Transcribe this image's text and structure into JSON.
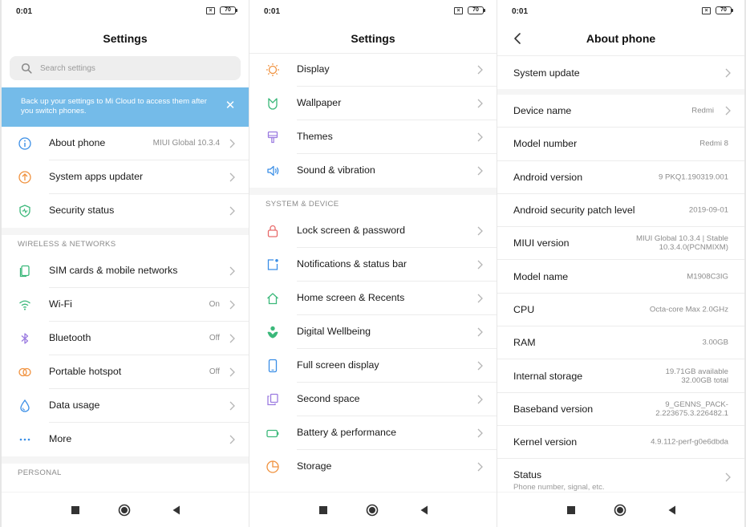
{
  "status": {
    "time": "0:01",
    "battery": "70"
  },
  "screen1": {
    "title": "Settings",
    "search_placeholder": "Search settings",
    "banner_text": "Back up your settings to Mi Cloud to access them after you switch phones.",
    "banner_close": "✕",
    "group1": [
      {
        "label": "About phone",
        "value": "MIUI Global 10.3.4",
        "icon": "info-icon"
      },
      {
        "label": "System apps updater",
        "value": "",
        "icon": "arrow-up-circle-icon"
      },
      {
        "label": "Security status",
        "value": "",
        "icon": "shield-check-icon"
      }
    ],
    "section_wireless": "WIRELESS & NETWORKS",
    "group2": [
      {
        "label": "SIM cards & mobile networks",
        "value": "",
        "icon": "sim-card-icon"
      },
      {
        "label": "Wi-Fi",
        "value": "On",
        "icon": "wifi-icon"
      },
      {
        "label": "Bluetooth",
        "value": "Off",
        "icon": "bluetooth-icon"
      },
      {
        "label": "Portable hotspot",
        "value": "Off",
        "icon": "hotspot-icon"
      },
      {
        "label": "Data usage",
        "value": "",
        "icon": "water-drop-icon"
      },
      {
        "label": "More",
        "value": "",
        "icon": "more-dots-icon"
      }
    ],
    "section_personal": "PERSONAL"
  },
  "screen2": {
    "title": "Settings",
    "group1": [
      {
        "label": "Display",
        "icon": "sun-icon"
      },
      {
        "label": "Wallpaper",
        "icon": "wallpaper-icon"
      },
      {
        "label": "Themes",
        "icon": "brush-icon"
      },
      {
        "label": "Sound & vibration",
        "icon": "speaker-icon"
      }
    ],
    "section_system": "SYSTEM & DEVICE",
    "group2": [
      {
        "label": "Lock screen & password",
        "icon": "lock-icon"
      },
      {
        "label": "Notifications & status bar",
        "icon": "notification-icon"
      },
      {
        "label": "Home screen & Recents",
        "icon": "home-icon"
      },
      {
        "label": "Digital Wellbeing",
        "icon": "wellbeing-icon"
      },
      {
        "label": "Full screen display",
        "icon": "phone-icon"
      },
      {
        "label": "Second space",
        "icon": "second-space-icon"
      },
      {
        "label": "Battery & performance",
        "icon": "battery-icon"
      },
      {
        "label": "Storage",
        "icon": "pie-chart-icon"
      }
    ]
  },
  "screen3": {
    "title": "About phone",
    "system_update": "System update",
    "rows": [
      {
        "label": "Device name",
        "value": "Redmi",
        "chevron": true
      },
      {
        "label": "Model number",
        "value": "Redmi 8",
        "chevron": false
      },
      {
        "label": "Android version",
        "value": "9 PKQ1.190319.001",
        "chevron": false
      },
      {
        "label": "Android security patch level",
        "value": "2019-09-01",
        "chevron": false
      },
      {
        "label": "MIUI version",
        "value": "MIUI Global 10.3.4 | Stable",
        "value2": "10.3.4.0(PCNMIXM)",
        "chevron": false
      },
      {
        "label": "Model name",
        "value": "M1908C3IG",
        "chevron": false
      },
      {
        "label": "CPU",
        "value": "Octa-core Max 2.0GHz",
        "chevron": false
      },
      {
        "label": "RAM",
        "value": "3.00GB",
        "chevron": false
      },
      {
        "label": "Internal storage",
        "value": "19.71GB available",
        "value2": "32.00GB total",
        "chevron": false
      },
      {
        "label": "Baseband version",
        "value": "9_GENNS_PACK-",
        "value2": "2.223675.3.226482.1",
        "chevron": false
      },
      {
        "label": "Kernel version",
        "value": "4.9.112-perf-g0e6dbda",
        "chevron": false
      }
    ],
    "status_label": "Status",
    "status_sub": "Phone number, signal, etc."
  },
  "colors": {
    "accent": "#3a8ee6",
    "banner": "#74bbe9",
    "orange": "#f0913d",
    "green": "#3bb87a",
    "purple": "#9b7be0"
  }
}
